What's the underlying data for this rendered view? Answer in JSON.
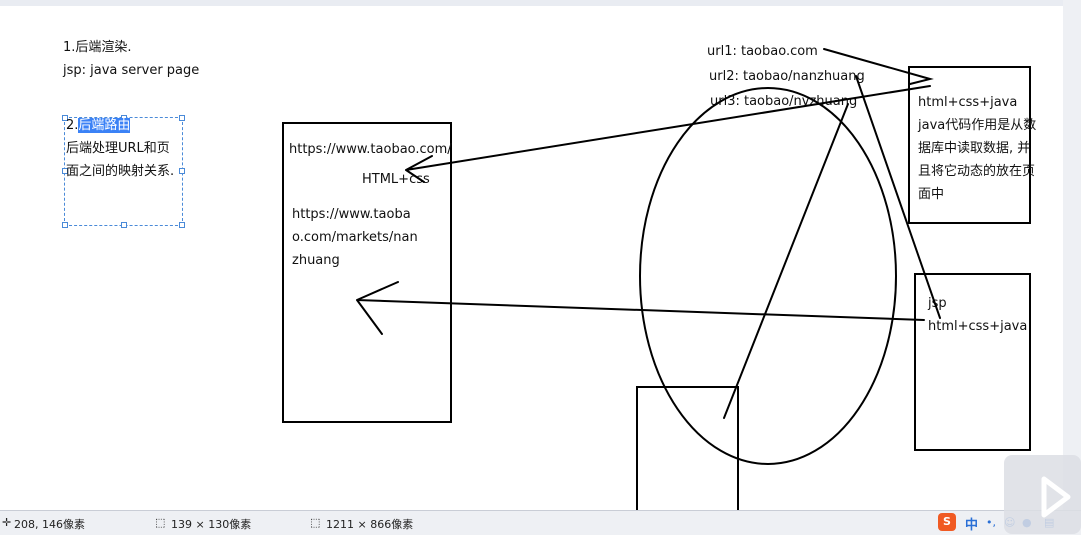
{
  "canvas": {
    "line1": "1.后端渲染.",
    "line2": "jsp: java server page",
    "sel_number": "2.",
    "sel_highlight": "后端路由",
    "sel_line2": "后端处理URL和页",
    "sel_line3": "面之间的映射关系."
  },
  "box_middle": {
    "url1": "https://www.taobao.com/",
    "html": "HTML+css",
    "url2_line1": "https://www.taoba",
    "url2_line2": "o.com/markets/nan",
    "url2_line3": "zhuang"
  },
  "urls": {
    "u1": "url1: taobao.com",
    "u2": "url2: taobao/nanzhuang",
    "u3": "url3: taobao/nvzhuang"
  },
  "box_right_top": {
    "l1": "html+css+java",
    "l2": "java代码作用是从数",
    "l3": "据库中读取数据, 并",
    "l4": "且将它动态的放在页",
    "l5": "面中"
  },
  "box_right_bottom": {
    "l1": "jsp",
    "l2": "html+css+java"
  },
  "statusbar": {
    "cursor": "208, 146像素",
    "selection_size": "139 × 130像素",
    "image_size": "1211 × 866像素",
    "ime_lang": "中",
    "ime_punct": "•,"
  },
  "icons": {
    "cursor": "crosshair-icon",
    "selection": "selection-rect-icon",
    "image": "image-size-icon",
    "ime": "sogou-ime-icon",
    "play": "play-icon"
  }
}
